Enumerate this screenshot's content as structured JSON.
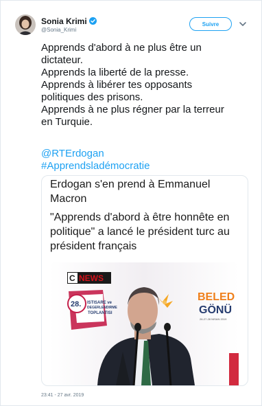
{
  "user": {
    "name": "Sonia Krimi",
    "handle": "@Sonia_Krimi"
  },
  "follow_label": "Suivre",
  "tweet": {
    "lines": [
      "Apprends d'abord à ne plus être un",
      "dictateur.",
      "Apprends la liberté de la presse.",
      "Apprends à libérer tes opposants",
      "politiques des prisons.",
      "Apprends à ne plus régner par la terreur",
      "en Turquie."
    ],
    "mention": "@RTErdogan",
    "hashtag": "#Apprendsladémocratie"
  },
  "media": {
    "caption_lines": [
      "Erdogan s'en prend à Emmanuel",
      "Macron",
      "\"Apprends d'abord à être honnête en",
      "politique\" a lancé le président turc au",
      "président français"
    ],
    "channel_logo": "C NEWS",
    "banner_number": "28.",
    "banner_lines": [
      "ISTISARE ve",
      "DEGERLENDIRME",
      "TOPLANTISI"
    ],
    "right_sign_lines": [
      "BELED",
      "GÖNÜ"
    ],
    "right_sign_small": "26-27-28 NISAN 2019"
  },
  "timestamp": "23:41 - 27 avr. 2019",
  "colors": {
    "accent": "#1da1f2",
    "secondary_text": "#657786",
    "logo_red": "#d4111a"
  }
}
